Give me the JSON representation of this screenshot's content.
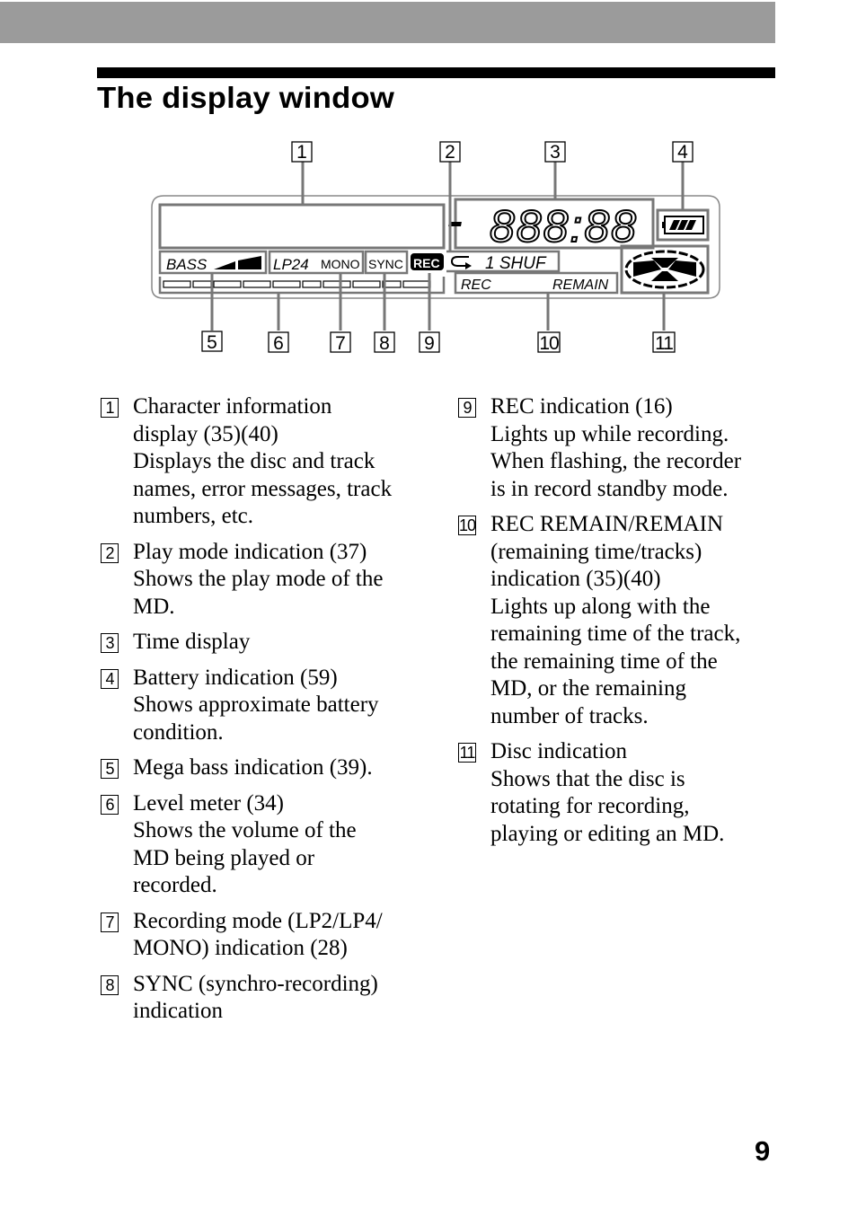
{
  "header": {
    "title": "The display window"
  },
  "diagram": {
    "callouts": [
      "1",
      "2",
      "3",
      "4",
      "5",
      "6",
      "7",
      "8",
      "9",
      "10",
      "11"
    ],
    "lcd": {
      "bass_label": "BASS",
      "lp_label": "LP24",
      "mono_label": "MONO",
      "sync_label": "SYNC",
      "rec_badge": "REC",
      "time_digits": "888:88",
      "minus_sign": "-",
      "play_mode_label": "1 SHUF",
      "rec_label": "REC",
      "remain_label": "REMAIN",
      "level_meter_segments": 10,
      "battery_bars": 3
    }
  },
  "items": [
    {
      "num": "1",
      "lines": [
        "Character information",
        "display (35)(40)",
        "Displays the disc and track",
        "names, error messages, track",
        "numbers, etc."
      ]
    },
    {
      "num": "2",
      "lines": [
        "Play mode indication (37)",
        "Shows the play mode of the",
        "MD."
      ]
    },
    {
      "num": "3",
      "lines": [
        "Time display"
      ]
    },
    {
      "num": "4",
      "lines": [
        "Battery indication (59)",
        "Shows approximate battery",
        "condition."
      ]
    },
    {
      "num": "5",
      "lines": [
        "Mega bass indication (39)."
      ]
    },
    {
      "num": "6",
      "lines": [
        "Level meter (34)",
        "Shows the volume of the",
        "MD being played or",
        "recorded."
      ]
    },
    {
      "num": "7",
      "lines": [
        "Recording mode (LP2/LP4/",
        "MONO) indication (28)"
      ]
    },
    {
      "num": "8",
      "lines": [
        "SYNC (synchro-recording)",
        "indication"
      ]
    },
    {
      "num": "9",
      "lines": [
        "REC indication (16)",
        "Lights up while recording.",
        "When flashing, the recorder",
        "is in record standby mode."
      ]
    },
    {
      "num": "10",
      "lines": [
        "REC REMAIN/REMAIN",
        "(remaining time/tracks)",
        "indication (35)(40)",
        "Lights up along with the",
        "remaining time of the track,",
        "the remaining time of the",
        "MD, or the remaining",
        "number of tracks."
      ]
    },
    {
      "num": "11",
      "lines": [
        "Disc indication",
        "Shows that the disc is",
        "rotating for recording,",
        "playing or editing an MD."
      ]
    }
  ],
  "footer": {
    "page_number": "9"
  }
}
